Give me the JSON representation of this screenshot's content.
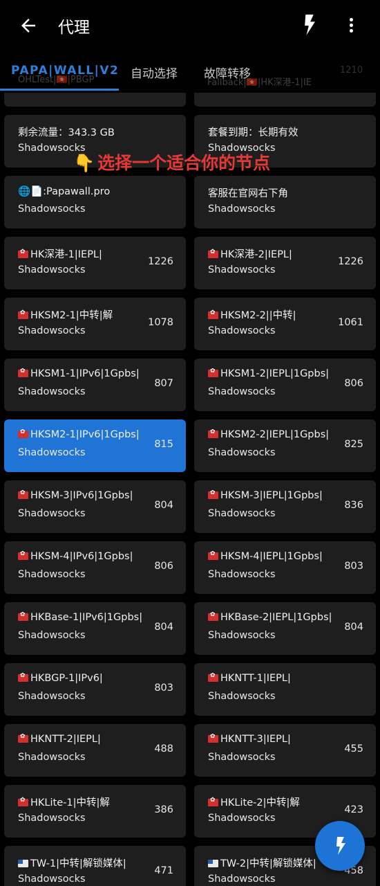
{
  "appbar": {
    "title": "代理",
    "back_icon": "arrow-left-icon",
    "speed_test_icon": "lightning-bolt-icon",
    "more_icon": "more-vert-icon"
  },
  "tabs": [
    {
      "label": "PAPA|WALL|V2",
      "active": true
    },
    {
      "label": "自动选择",
      "active": false
    },
    {
      "label": "故障转移",
      "active": false
    }
  ],
  "tabs_subtext": {
    "auto_value": "OHLTest|🇭🇰|PBGP",
    "fail_value": "Fallback|🇭🇰|HK深港-1|IE",
    "fail_delay": "1210"
  },
  "overlay_text": "选择一个适合你的节点",
  "accent_color": "#2e7fd8",
  "selected_color": "#1f74d6",
  "nodes": [
    {
      "name": "剩余流量：343.3 GB",
      "type": "Shadowsocks",
      "delay": "",
      "flag": ""
    },
    {
      "name": "套餐到期：长期有效",
      "type": "Shadowsocks",
      "delay": "",
      "flag": ""
    },
    {
      "name": "🌐📄:Papawall.pro",
      "type": "Shadowsocks",
      "delay": "",
      "flag": ""
    },
    {
      "name": "客服在官网右下角",
      "type": "Shadowsocks",
      "delay": "",
      "flag": ""
    },
    {
      "name": "HK深港-1|IEPL|",
      "type": "Shadowsocks",
      "delay": "1226",
      "flag": "hk"
    },
    {
      "name": "HK深港-2|IEPL|",
      "type": "Shadowsocks",
      "delay": "1226",
      "flag": "hk"
    },
    {
      "name": "HKSM2-1|中转|解",
      "type": "Shadowsocks",
      "delay": "1078",
      "flag": "hk"
    },
    {
      "name": "HKSM2-2||中转|",
      "type": "Shadowsocks",
      "delay": "1061",
      "flag": "hk"
    },
    {
      "name": "HKSM1-1|IPv6|1Gpbs|",
      "type": "Shadowsocks",
      "delay": "807",
      "flag": "hk"
    },
    {
      "name": "HKSM1-2|IEPL|1Gpbs|",
      "type": "Shadowsocks",
      "delay": "806",
      "flag": "hk"
    },
    {
      "name": "HKSM2-1|IPv6|1Gpbs|",
      "type": "Shadowsocks",
      "delay": "815",
      "flag": "hk",
      "selected": true
    },
    {
      "name": "HKSM2-2|IEPL|1Gpbs|",
      "type": "Shadowsocks",
      "delay": "825",
      "flag": "hk"
    },
    {
      "name": "HKSM-3|IPv6|1Gpbs|",
      "type": "Shadowsocks",
      "delay": "804",
      "flag": "hk"
    },
    {
      "name": "HKSM-3|IEPL|1Gpbs|",
      "type": "Shadowsocks",
      "delay": "836",
      "flag": "hk"
    },
    {
      "name": "HKSM-4|IPv6|1Gpbs|",
      "type": "Shadowsocks",
      "delay": "806",
      "flag": "hk"
    },
    {
      "name": "HKSM-4|IEPL|1Gpbs|",
      "type": "Shadowsocks",
      "delay": "803",
      "flag": "hk"
    },
    {
      "name": "HKBase-1|IPv6|1Gpbs|",
      "type": "Shadowsocks",
      "delay": "804",
      "flag": "hk"
    },
    {
      "name": "HKBase-2|IEPL|1Gpbs|",
      "type": "Shadowsocks",
      "delay": "804",
      "flag": "hk"
    },
    {
      "name": "HKBGP-1|IPv6|",
      "type": "Shadowsocks",
      "delay": "803",
      "flag": "hk"
    },
    {
      "name": "HKNTT-1|IEPL|",
      "type": "Shadowsocks",
      "delay": "",
      "flag": "hk"
    },
    {
      "name": "HKNTT-2|IEPL|",
      "type": "Shadowsocks",
      "delay": "488",
      "flag": "hk"
    },
    {
      "name": "HKNTT-3|IEPL|",
      "type": "Shadowsocks",
      "delay": "455",
      "flag": "hk"
    },
    {
      "name": "HKLite-1|中转|解",
      "type": "Shadowsocks",
      "delay": "386",
      "flag": "hk"
    },
    {
      "name": "HKLite-2|中转|解",
      "type": "Shadowsocks",
      "delay": "423",
      "flag": "hk"
    },
    {
      "name": "TW-1|中转|解锁媒体|",
      "type": "Shadowsocks",
      "delay": "471",
      "flag": "tw"
    },
    {
      "name": "TW-2|中转|解锁媒体|",
      "type": "Shadowsocks",
      "delay": "458",
      "flag": "tw"
    }
  ],
  "fab_icon": "lightning-bolt-icon"
}
